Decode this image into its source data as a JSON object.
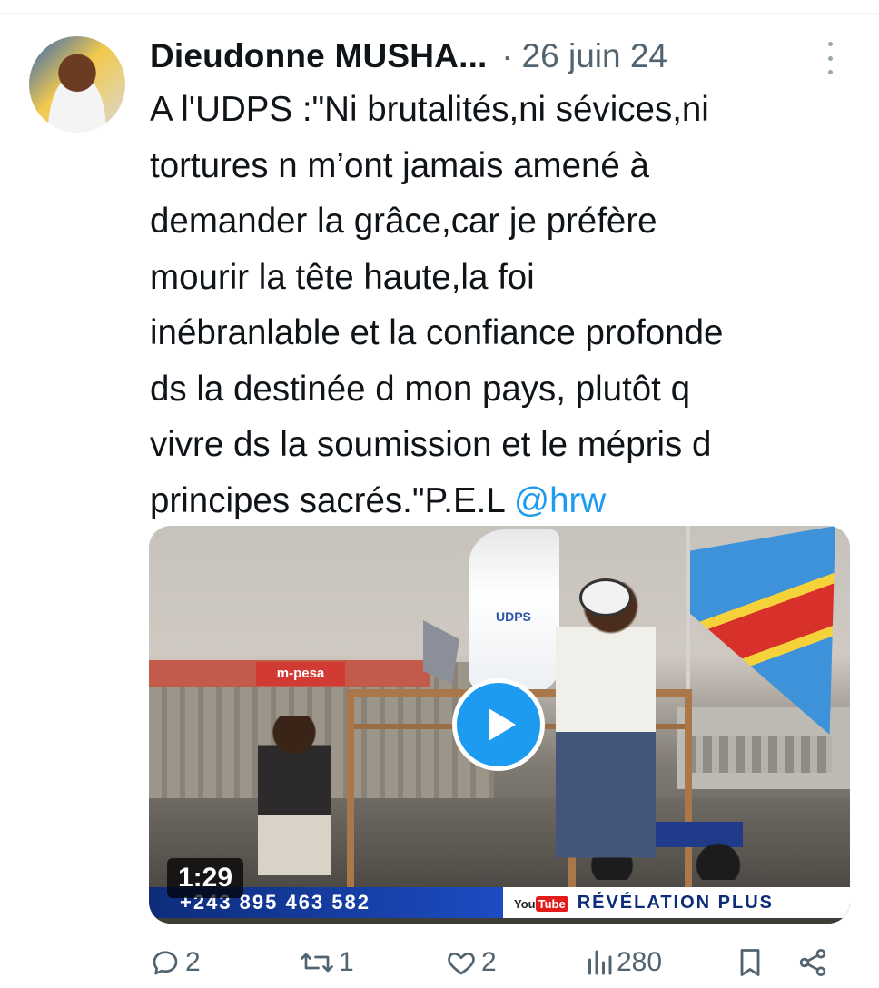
{
  "tweet": {
    "author": {
      "display_name": "Dieudonne MUSHA...",
      "avatar": "avatar-photo"
    },
    "separator": "·",
    "date": "26 juin 24",
    "text_lines": [
      "A l'UDPS :\"Ni brutalités,ni sévices,ni",
      "tortures n m’ont jamais amené à",
      "demander la grâce,car je préfère",
      "mourir la tête haute,la foi",
      "inébranlable et la confiance profonde",
      "ds la destinée d mon pays, plutôt q",
      "vivre ds la soumission et le mépris d",
      "principes sacrés.\"P.E.L "
    ],
    "mention": "@hrw",
    "media": {
      "duration": "1:29",
      "ticker_phone": "+243 895 463 582",
      "ticker_logo": "You",
      "ticker_logo_tube": "Tube",
      "ticker_channel": "RÉVÉLATION PLUS",
      "stadium_sign": "m-pesa",
      "flag_label": "UDPS",
      "play_icon": "play-icon"
    },
    "actions": {
      "replies": "2",
      "reposts": "1",
      "likes": "2",
      "views": "280"
    }
  },
  "colors": {
    "accent": "#1d9bf0",
    "text": "#0f1419",
    "secondary": "#536471"
  }
}
